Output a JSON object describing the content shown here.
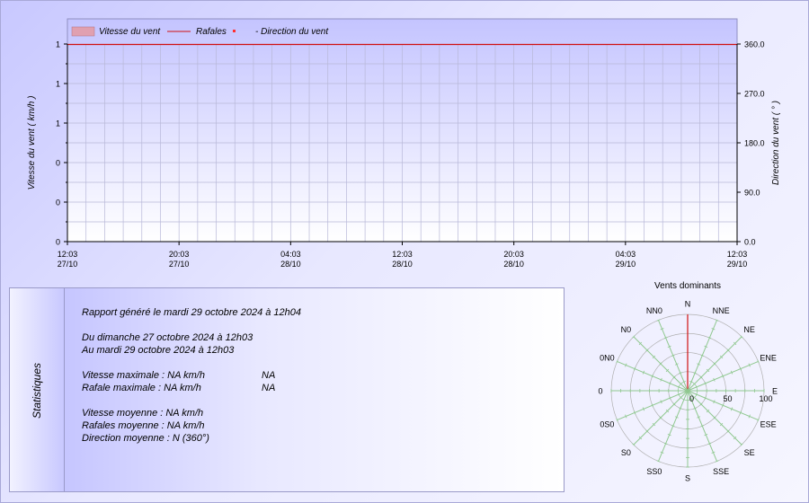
{
  "chart_data": [
    {
      "type": "line",
      "legend": {
        "placement": "top-left",
        "items": [
          "Vitesse du vent",
          "Rafales",
          "Direction du vent"
        ]
      },
      "ylabel_left": "Vitesse du vent ( km/h )",
      "ylabel_right": "Direction du vent ( ° )",
      "y_ticks_left": [
        "1",
        "1",
        "1",
        "0",
        "0",
        "0"
      ],
      "y_ticks_right": [
        "360.0",
        "270.0",
        "180.0",
        "90.0",
        "0.0"
      ],
      "ylim_right": [
        0,
        360
      ],
      "x_ticks": [
        {
          "time": "12:03",
          "date": "27/10"
        },
        {
          "time": "20:03",
          "date": "27/10"
        },
        {
          "time": "04:03",
          "date": "28/10"
        },
        {
          "time": "12:03",
          "date": "28/10"
        },
        {
          "time": "20:03",
          "date": "28/10"
        },
        {
          "time": "04:03",
          "date": "29/10"
        },
        {
          "time": "12:03",
          "date": "29/10"
        }
      ],
      "series": [
        {
          "name": "Vitesse du vent",
          "values": []
        },
        {
          "name": "Rafales",
          "values": []
        },
        {
          "name": "Direction du vent",
          "values": []
        }
      ],
      "grid": true,
      "colors": {
        "vitesse": "#e0a0b0",
        "rafales": "#d01010",
        "direction": "#ff3030"
      }
    },
    {
      "type": "radar",
      "title": "Vents dominants",
      "directions": [
        "N",
        "NNE",
        "NE",
        "ENE",
        "E",
        "ESE",
        "SE",
        "SSE",
        "S",
        "SS0",
        "S0",
        "0S0",
        "0",
        "0N0",
        "N0",
        "NN0"
      ],
      "rings": [
        "0",
        "50",
        "100"
      ],
      "dominant": "N",
      "dominant_value": 100,
      "colors": {
        "spokes": "#90c890",
        "dominant": "#d01010"
      }
    }
  ],
  "stats": {
    "title": "Statistiques",
    "report": "Rapport généré le mardi 29 octobre 2024 à 12h04",
    "from": "Du dimanche 27 octobre 2024 à 12h03",
    "to": "Au mardi 29 octobre 2024 à 12h03",
    "vmax_label": "Vitesse maximale : NA km/h",
    "vmax_extra": "NA",
    "rmax_label": "Rafale maximale : NA km/h",
    "rmax_extra": "NA",
    "vavg": "Vitesse moyenne : NA km/h",
    "ravg": "Rafales moyenne : NA km/h",
    "davg": "Direction moyenne : N (360°)"
  }
}
